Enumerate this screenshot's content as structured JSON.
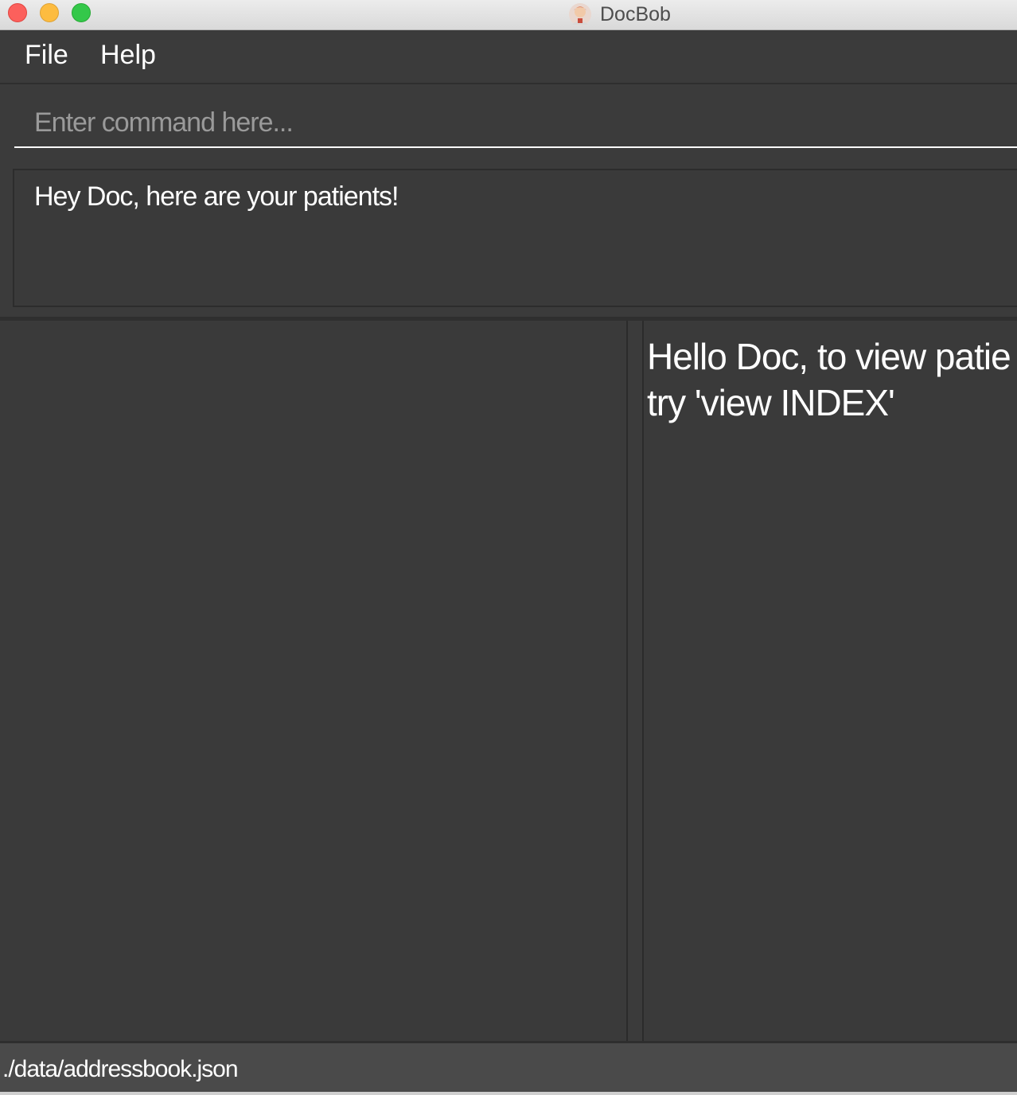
{
  "window": {
    "title": "DocBob",
    "app_icon": "docbob-avatar-icon"
  },
  "menu": {
    "file_label": "File",
    "help_label": "Help"
  },
  "command": {
    "placeholder": "Enter command here...",
    "value": ""
  },
  "result": {
    "message": "Hey Doc, here are your patients!"
  },
  "detail": {
    "line1": "Hello Doc, to view patie",
    "line2": "try 'view INDEX'"
  },
  "status": {
    "file_path": "./data/addressbook.json"
  },
  "colors": {
    "background": "#3b3b3b",
    "text": "#ffffff",
    "placeholder": "#9a9a9a"
  }
}
